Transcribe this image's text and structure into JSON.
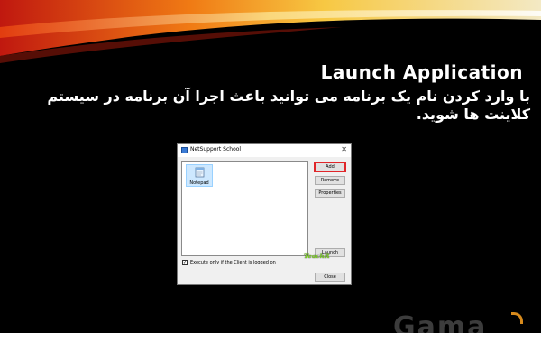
{
  "slide": {
    "title": "Launch Application",
    "body": "با وارد کردن نام یک برنامه می توانید باعث اجرا آن برنامه در سیستم کلاینت ها شوید."
  },
  "dialog": {
    "title": "NetSupport School",
    "close_glyph": "✕",
    "list_items": [
      {
        "label": "Notepad",
        "icon": "notepad-icon"
      }
    ],
    "buttons": {
      "add": "Add",
      "remove": "Remove",
      "properties": "Properties",
      "launch": "Launch",
      "close": "Close"
    },
    "checkbox": {
      "label": "Execute only if the Client is logged on",
      "checked": true,
      "mark": "✓"
    },
    "badge": "TeachR"
  },
  "watermark": "Gama",
  "colors": {
    "slide_bg": "#000000",
    "highlight": "#e0262a",
    "accent": "#d78a1c"
  }
}
